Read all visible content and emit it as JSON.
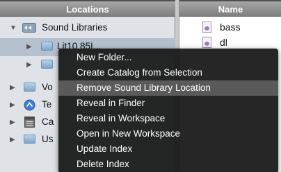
{
  "locations": {
    "header": "Locations",
    "items": [
      {
        "label": "Sound Libraries",
        "icon": "sound-libraries-icon",
        "expanded": true
      },
      {
        "label": "Lit10 85I...",
        "icon": "folder-icon",
        "selected": true
      },
      {
        "label": "",
        "icon": "folder-icon"
      },
      {
        "label": "Vo",
        "icon": "folder-icon"
      },
      {
        "label": "Te",
        "icon": "compass-icon"
      },
      {
        "label": "Ca",
        "icon": "catalog-icon"
      },
      {
        "label": "Us",
        "icon": "folder-icon"
      }
    ]
  },
  "names": {
    "header": "Name",
    "files": [
      "bass",
      "dl"
    ]
  },
  "context_menu": {
    "items": [
      {
        "label": "New Folder..."
      },
      {
        "label": "Create Catalog from Selection"
      },
      {
        "label": "Remove Sound Library Location",
        "highlighted": true
      },
      {
        "label": "Reveal in Finder"
      },
      {
        "label": "Reveal in Workspace"
      },
      {
        "label": "Open in New Workspace"
      },
      {
        "label": "Update Index"
      },
      {
        "label": "Delete Index"
      }
    ]
  },
  "colors": {
    "menu_background": "#181818",
    "menu_highlight": "#5a5a5a",
    "selection": "#b5c0cf"
  }
}
